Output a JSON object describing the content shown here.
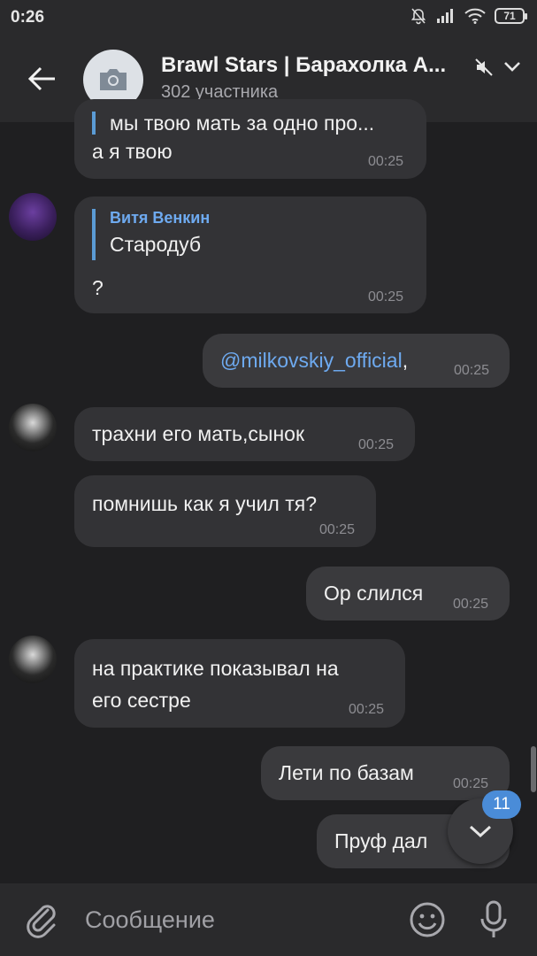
{
  "status_bar": {
    "time": "0:26",
    "battery": "71"
  },
  "header": {
    "title": "Brawl Stars | Барахолка А...",
    "subtitle": "302 участника"
  },
  "messages": [
    {
      "text": "мы твою мать за одно про...",
      "text2": "а я твою",
      "time": "00:25"
    },
    {
      "reply_name": "Витя Венкин",
      "reply_text": "Стародуб",
      "text": "?",
      "time": "00:25"
    },
    {
      "mention": "@milkovskiy_official",
      "suffix": ",",
      "time": "00:25"
    },
    {
      "text": "трахни его мать,сынок",
      "time": "00:25"
    },
    {
      "text": "помнишь как я учил тя?",
      "time": "00:25"
    },
    {
      "text": "Ор слился",
      "time": "00:25"
    },
    {
      "text": "на практике показывал на",
      "text2": "его сестре",
      "time": "00:25"
    },
    {
      "text": "Лети по базам",
      "time": "00:25"
    },
    {
      "text": "Пруф дал"
    }
  ],
  "unread_badge": "11",
  "input": {
    "placeholder": "Сообщение"
  },
  "colors": {
    "accent": "#4a8cd8",
    "bubble": "#333336",
    "background": "#1f1f21"
  }
}
